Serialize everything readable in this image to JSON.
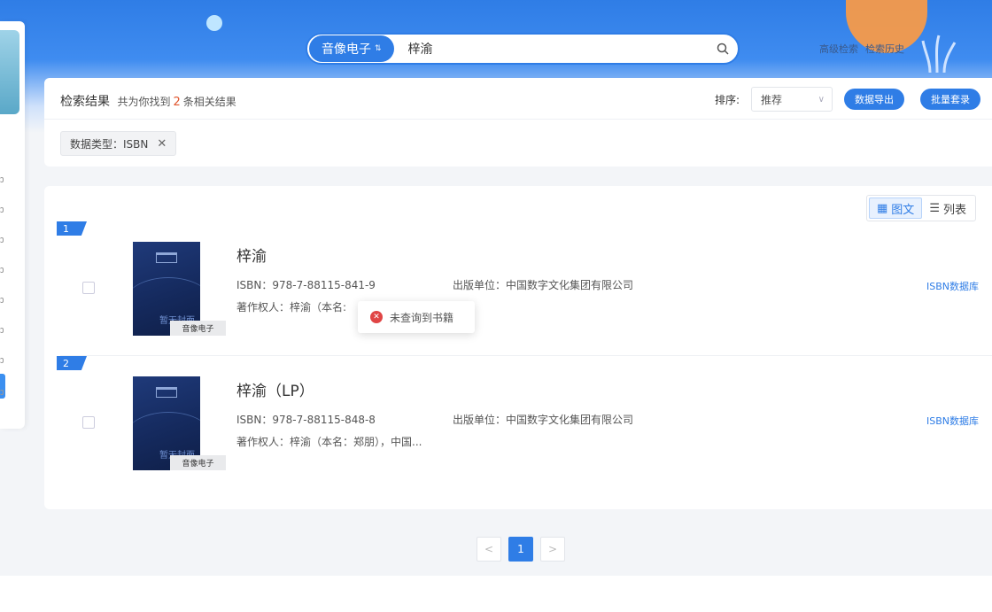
{
  "search": {
    "type_label": "音像电子",
    "query": "梓渝"
  },
  "top_links": {
    "advanced": "高级检索",
    "history": "检索历史"
  },
  "results": {
    "title": "检索结果",
    "summary_prefix": "共为你找到",
    "count": "2",
    "summary_suffix": "条相关结果",
    "sort_label": "排序:",
    "sort_value": "推荐",
    "export_label": "数据导出",
    "batch_label": "批量套录",
    "filter_tag": "数据类型：ISBN"
  },
  "view": {
    "grid_label": "图文",
    "list_label": "列表"
  },
  "items": [
    {
      "index": "1",
      "title": "梓渝",
      "isbn": "ISBN：978-7-88115-841-9",
      "publisher": "出版单位：中国数字文化集团有限公司",
      "copyright": "著作权人：梓渝（本名:",
      "tag": "音像电子",
      "cover_text": "暂无封面",
      "db": "ISBN数据库"
    },
    {
      "index": "2",
      "title": "梓渝（LP）",
      "isbn": "ISBN：978-7-88115-848-8",
      "publisher": "出版单位：中国数字文化集团有限公司",
      "copyright": "著作权人：梓渝（本名：郑朋），中国...",
      "tag": "音像电子",
      "cover_text": "暂无封面",
      "db": "ISBN数据库"
    }
  ],
  "tooltip": {
    "message": "未查询到书籍"
  },
  "pagination": {
    "prev": "<",
    "current": "1",
    "next": ">"
  },
  "colors": {
    "primary": "#2f7de6",
    "error": "#e04545",
    "count": "#e0542c"
  }
}
